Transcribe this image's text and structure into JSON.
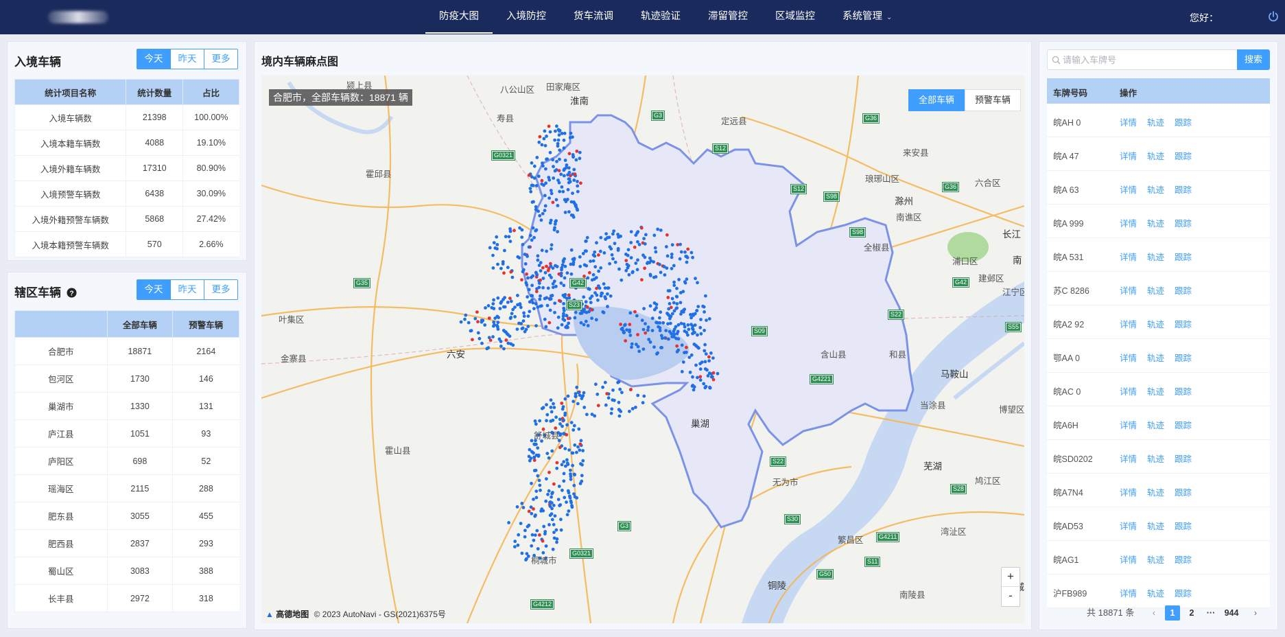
{
  "nav": {
    "items": [
      "防疫大图",
      "入境防控",
      "货车流调",
      "轨迹验证",
      "滞留管控",
      "区域监控",
      "系统管理"
    ],
    "active_index": 0,
    "greeting": "您好："
  },
  "entry_panel": {
    "title": "入境车辆",
    "segments": [
      "今天",
      "昨天",
      "更多"
    ],
    "active_segment": 0,
    "columns": [
      "统计项目名称",
      "统计数量",
      "占比"
    ],
    "rows": [
      [
        "入境车辆数",
        "21398",
        "100.00%"
      ],
      [
        "入境本籍车辆数",
        "4088",
        "19.10%"
      ],
      [
        "入境外籍车辆数",
        "17310",
        "80.90%"
      ],
      [
        "入境预警车辆数",
        "6438",
        "30.09%"
      ],
      [
        "入境外籍预警车辆数",
        "5868",
        "27.42%"
      ],
      [
        "入境本籍预警车辆数",
        "570",
        "2.66%"
      ]
    ]
  },
  "district_panel": {
    "title": "辖区车辆",
    "help_icon": "question-circle-icon",
    "segments": [
      "今天",
      "昨天",
      "更多"
    ],
    "active_segment": 0,
    "columns": [
      "",
      "全部车辆",
      "预警车辆"
    ],
    "rows": [
      [
        "合肥市",
        "18871",
        "2164"
      ],
      [
        "包河区",
        "1730",
        "146"
      ],
      [
        "巢湖市",
        "1330",
        "131"
      ],
      [
        "庐江县",
        "1051",
        "93"
      ],
      [
        "庐阳区",
        "698",
        "52"
      ],
      [
        "瑶海区",
        "2115",
        "288"
      ],
      [
        "肥东县",
        "3055",
        "455"
      ],
      [
        "肥西县",
        "2837",
        "293"
      ],
      [
        "蜀山区",
        "3083",
        "388"
      ],
      [
        "长丰县",
        "2972",
        "318"
      ]
    ]
  },
  "map_panel": {
    "title": "境内车辆麻点图",
    "overlay_label": "合肥市，全部车辆数：18871 辆",
    "toggle": [
      "全部车辆",
      "预警车辆"
    ],
    "active_toggle": 0,
    "zoom_in": "+",
    "zoom_out": "-",
    "copyright_brand": "高德地图",
    "copyright": "© 2023 AutoNavi - GS(2021)6375号",
    "places": [
      "颍上县",
      "八公山区",
      "田家庵区",
      "淮南",
      "寿县",
      "定远县",
      "来安县",
      "霍邱县",
      "琅琊山区",
      "六合区",
      "滁州",
      "南谯区",
      "长江",
      "全椒县",
      "浦口区",
      "南",
      "建邺区",
      "江宁区",
      "叶集区",
      "六安",
      "金寨县",
      "含山县",
      "和县",
      "马鞍山",
      "当涂县",
      "博望区",
      "巢湖",
      "舒城县",
      "霍山县",
      "无为市",
      "芜湖",
      "鸠江区",
      "湾沚区",
      "桐城市",
      "繁昌区",
      "南陵县",
      "铜陵",
      "宣城"
    ],
    "highways": [
      "G3",
      "G36",
      "G0321",
      "S12",
      "S12",
      "S98",
      "G36",
      "S98",
      "G35",
      "G42",
      "S22",
      "S55",
      "S09",
      "G4221",
      "S22",
      "S28",
      "S30",
      "G4211",
      "S11",
      "G50",
      "G3",
      "G0321",
      "G4212",
      "G42",
      "S23"
    ],
    "colors": {
      "normal_dot": "#1f6fe5",
      "warning_dot": "#e5322d",
      "boundary": "#7b93e6",
      "lake": "#b9cdf0"
    }
  },
  "vehicle_list": {
    "search_placeholder": "请输入车牌号",
    "search_button": "搜索",
    "columns": [
      "车牌号码",
      "操作"
    ],
    "actions": [
      "详情",
      "轨迹",
      "跟踪"
    ],
    "plates": [
      "皖AH  0",
      "皖A  47",
      "皖A  63",
      "皖A  999",
      "皖A  531",
      "苏C  8286",
      "皖A2  92",
      "鄂AA  0",
      "皖AC  0",
      "皖A6H",
      "皖SD0202",
      "皖A7N4",
      "皖AD53",
      "皖AG1",
      "沪FB989"
    ],
    "total_text": "共 18871 条",
    "pages": [
      "1",
      "2",
      "···",
      "944"
    ],
    "active_page": "1"
  }
}
